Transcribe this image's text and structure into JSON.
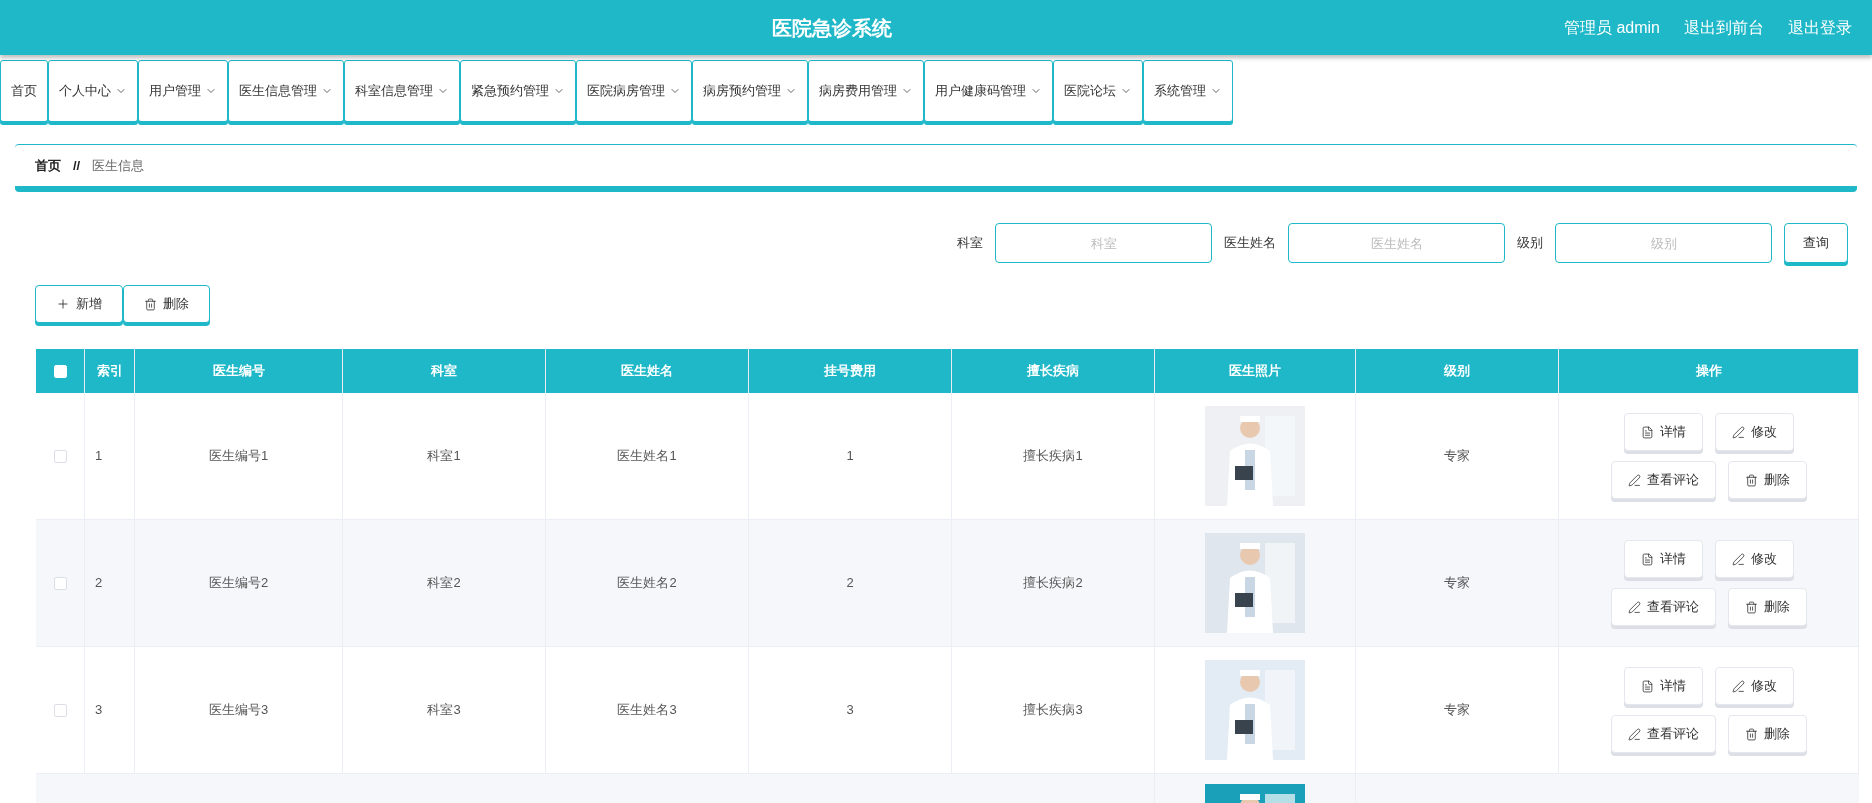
{
  "header": {
    "title": "医院急诊系统",
    "links": [
      "管理员 admin",
      "退出到前台",
      "退出登录"
    ]
  },
  "nav": [
    {
      "label": "首页",
      "has_menu": false
    },
    {
      "label": "个人中心",
      "has_menu": true
    },
    {
      "label": "用户管理",
      "has_menu": true
    },
    {
      "label": "医生信息管理",
      "has_menu": true
    },
    {
      "label": "科室信息管理",
      "has_menu": true
    },
    {
      "label": "紧急预约管理",
      "has_menu": true
    },
    {
      "label": "医院病房管理",
      "has_menu": true
    },
    {
      "label": "病房预约管理",
      "has_menu": true
    },
    {
      "label": "病房费用管理",
      "has_menu": true
    },
    {
      "label": "用户健康码管理",
      "has_menu": true
    },
    {
      "label": "医院论坛",
      "has_menu": true
    },
    {
      "label": "系统管理",
      "has_menu": true
    }
  ],
  "breadcrumb": {
    "home": "首页",
    "separator": "//",
    "current": "医生信息"
  },
  "search": {
    "fields": [
      {
        "label": "科室",
        "placeholder": "科室"
      },
      {
        "label": "医生姓名",
        "placeholder": "医生姓名"
      },
      {
        "label": "级别",
        "placeholder": "级别"
      }
    ],
    "button": "查询"
  },
  "actions": [
    {
      "kind": "add",
      "label": "新增"
    },
    {
      "kind": "delete",
      "label": "删除"
    }
  ],
  "table": {
    "select_all": {
      "checked": false
    },
    "columns": [
      "索引",
      "医生编号",
      "科室",
      "医生姓名",
      "挂号费用",
      "擅长疾病",
      "医生照片",
      "级别",
      "操作"
    ],
    "rows": [
      {
        "checked": false,
        "cells": [
          "1",
          "医生编号1",
          "科室1",
          "医生姓名1",
          "1",
          "擅长疾病1"
        ],
        "level": "专家",
        "buttons": [
          {
            "kind": "detail",
            "label": "详情"
          },
          {
            "kind": "edit",
            "label": "修改"
          },
          {
            "kind": "comment",
            "label": "查看评论"
          },
          {
            "kind": "delete",
            "label": "删除"
          }
        ]
      },
      {
        "checked": false,
        "cells": [
          "2",
          "医生编号2",
          "科室2",
          "医生姓名2",
          "2",
          "擅长疾病2"
        ],
        "level": "专家",
        "buttons": [
          {
            "kind": "detail",
            "label": "详情"
          },
          {
            "kind": "edit",
            "label": "修改"
          },
          {
            "kind": "comment",
            "label": "查看评论"
          },
          {
            "kind": "delete",
            "label": "删除"
          }
        ]
      },
      {
        "checked": false,
        "cells": [
          "3",
          "医生编号3",
          "科室3",
          "医生姓名3",
          "3",
          "擅长疾病3"
        ],
        "level": "专家",
        "buttons": [
          {
            "kind": "detail",
            "label": "详情"
          },
          {
            "kind": "edit",
            "label": "修改"
          },
          {
            "kind": "comment",
            "label": "查看评论"
          },
          {
            "kind": "delete",
            "label": "删除"
          }
        ]
      }
    ]
  }
}
